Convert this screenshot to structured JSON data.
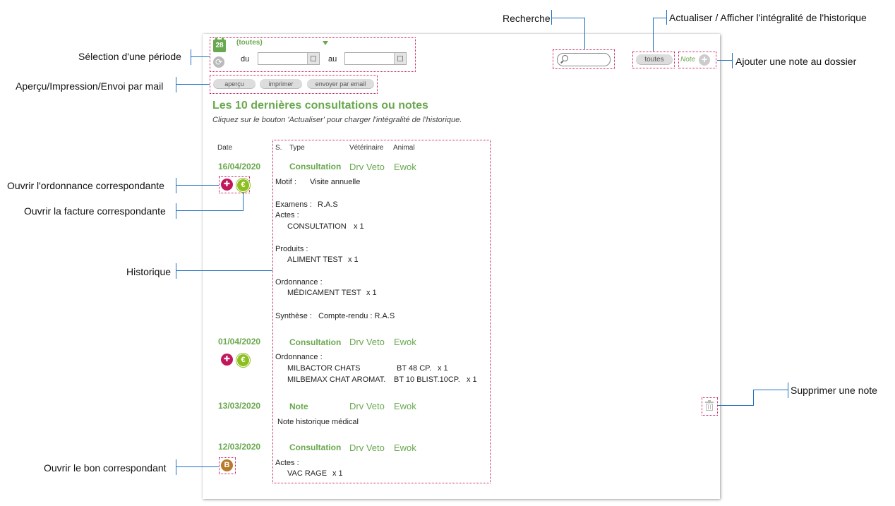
{
  "callouts": {
    "recherche": "Recherche",
    "actualiser": "Actualiser / Afficher l'intégralité de l'historique",
    "selection_periode": "Sélection d'une période",
    "ajouter_note": "Ajouter une note au dossier",
    "apercu_impression": "Aperçu/Impression/Envoi par mail",
    "ordonnance": "Ouvrir l'ordonnance correspondante",
    "facture": "Ouvrir la facture correspondante",
    "historique": "Historique",
    "supprimer_note": "Supprimer une note",
    "bon": "Ouvrir le bon correspondant"
  },
  "period": {
    "calendar_day": "28",
    "selected": "(toutes)",
    "from_label": "du",
    "to_label": "au",
    "from_value": "",
    "to_value": ""
  },
  "toolbar": {
    "preview": "aperçu",
    "print": "imprimer",
    "email": "envoyer par email"
  },
  "search": {
    "value": ""
  },
  "refresh_button": "toutes",
  "note_button": "Note",
  "heading": {
    "title": "Les 10 dernières consultations ou notes",
    "subtitle": "Cliquez sur le bouton 'Actualiser' pour charger l'intégralité de l'historique."
  },
  "columns": {
    "date": "Date",
    "status": "S.",
    "type": "Type",
    "vet": "Vétérinaire",
    "animal": "Animal"
  },
  "entries": {
    "e1": {
      "date": "16/04/2020",
      "type": "Consultation",
      "vet": "Drv Veto",
      "animal": "Ewok",
      "motif_label": "Motif :",
      "motif": "Visite annuelle",
      "examens_label": "Examens :",
      "examens": "R.A.S",
      "actes_label": "Actes :",
      "acte1": "CONSULTATION",
      "acte1_qty": "x 1",
      "produits_label": "Produits :",
      "produit1": "ALIMENT TEST",
      "produit1_qty": "x 1",
      "ordonnance_label": "Ordonnance :",
      "ord1": "MÉDICAMENT TEST",
      "ord1_qty": "x 1",
      "synthese_label": "Synthèse :",
      "synthese": "Compte-rendu : R.A.S"
    },
    "e2": {
      "date": "01/04/2020",
      "type": "Consultation",
      "vet": "Drv Veto",
      "animal": "Ewok",
      "ordonnance_label": "Ordonnance :",
      "ord1": "MILBACTOR CHATS",
      "ord1_pack": "BT 48 CP.",
      "ord1_qty": "x 1",
      "ord2": "MILBEMAX CHAT AROMAT.",
      "ord2_pack": "BT 10 BLIST.10CP.",
      "ord2_qty": "x 1"
    },
    "e3": {
      "date": "13/03/2020",
      "type": "Note",
      "vet": "Drv Veto",
      "animal": "Ewok",
      "text": "Note historique médical"
    },
    "e4": {
      "date": "12/03/2020",
      "type": "Consultation",
      "vet": "Drv Veto",
      "animal": "Ewok",
      "actes_label": "Actes :",
      "acte1": "VAC RAGE",
      "acte1_qty": "x 1"
    }
  },
  "icons": {
    "ordonnance_symbol": "✚",
    "facture_symbol": "€",
    "bon_symbol": "B"
  },
  "colors": {
    "accent_green": "#6aa84f",
    "ordonnance": "#c2185b",
    "facture": "#8dbf1f",
    "bon": "#b8792a",
    "callout_line": "#1f6fc0",
    "dotted_border": "#c2185b"
  }
}
